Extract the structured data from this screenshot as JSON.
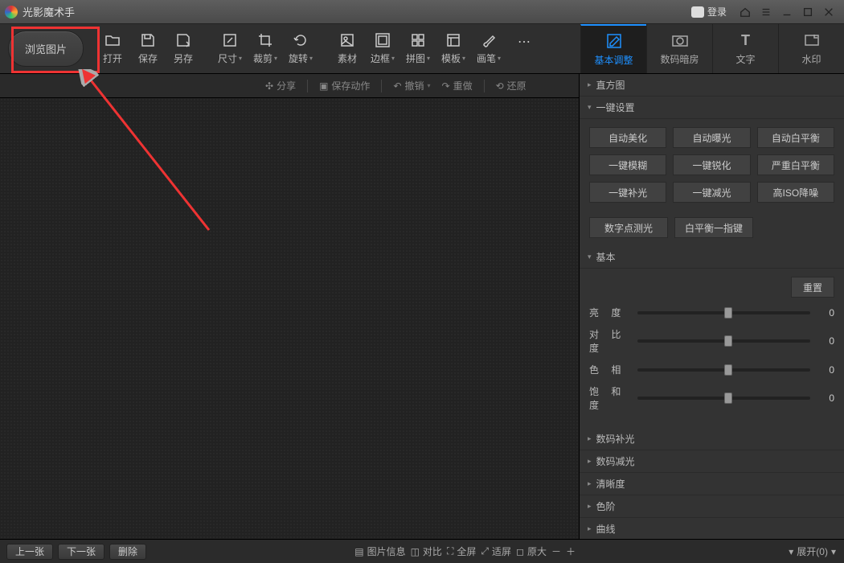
{
  "title": "光影魔术手",
  "login": "登录",
  "browse": "浏览图片",
  "tools": {
    "open": "打开",
    "save": "保存",
    "saveas": "另存",
    "size": "尺寸",
    "crop": "裁剪",
    "rotate": "旋转",
    "material": "素材",
    "frame": "边框",
    "collage": "拼图",
    "template": "模板",
    "brush": "画笔",
    "more": "…"
  },
  "rtabs": {
    "basic": "基本调整",
    "darkroom": "数码暗房",
    "text": "文字",
    "watermark": "水印"
  },
  "subbar": {
    "share": "分享",
    "saveaction": "保存动作",
    "undo": "撤销",
    "redo": "重做",
    "restore": "还原"
  },
  "panel": {
    "histogram": "直方图",
    "oneclick": "一键设置",
    "oneclick_btns": [
      "自动美化",
      "自动曝光",
      "自动白平衡",
      "一键模糊",
      "一键锐化",
      "严重白平衡",
      "一键补光",
      "一键减光",
      "高ISO降噪"
    ],
    "oneclick_row2": [
      "数字点测光",
      "白平衡一指键"
    ],
    "basic": "基本",
    "reset": "重置",
    "sliders": [
      {
        "label": "亮   度",
        "value": 0,
        "pos": 50
      },
      {
        "label": "对 比 度",
        "value": 0,
        "pos": 50
      },
      {
        "label": "色   相",
        "value": 0,
        "pos": 50
      },
      {
        "label": "饱 和 度",
        "value": 0,
        "pos": 50
      }
    ],
    "collapsed": [
      "数码补光",
      "数码减光",
      "清晰度",
      "色阶",
      "曲线"
    ]
  },
  "bottom": {
    "prev": "上一张",
    "next": "下一张",
    "delete": "删除",
    "info": "图片信息",
    "compare": "对比",
    "fullscreen": "全屏",
    "fit": "适屏",
    "original": "原大"
  },
  "expand": "展开(0)"
}
